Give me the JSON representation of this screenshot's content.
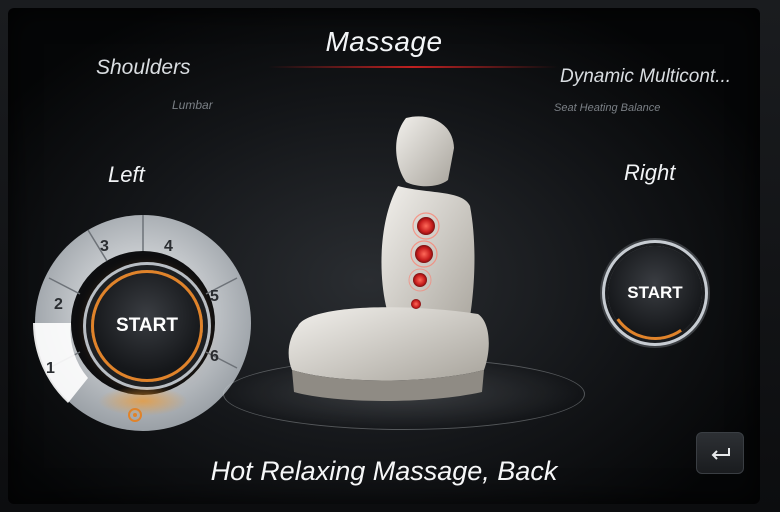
{
  "header": {
    "title": "Massage"
  },
  "options": {
    "left_main": "Shoulders",
    "left_sub": "Lumbar",
    "right_main": "Dynamic Multicont...",
    "right_sub": "Seat Heating Balance"
  },
  "left": {
    "label": "Left",
    "start_label": "START",
    "segments": [
      "1",
      "2",
      "3",
      "4",
      "5",
      "6"
    ],
    "selected_segment": "1"
  },
  "right": {
    "label": "Right",
    "start_label": "START"
  },
  "status": {
    "program": "Hot Relaxing Massage, Back"
  },
  "colors": {
    "accent": "#e0832a",
    "active_red": "#c02020"
  },
  "icons": {
    "back": "back-icon",
    "indicator": "massage-indicator-icon",
    "seat": "seat-illustration"
  }
}
